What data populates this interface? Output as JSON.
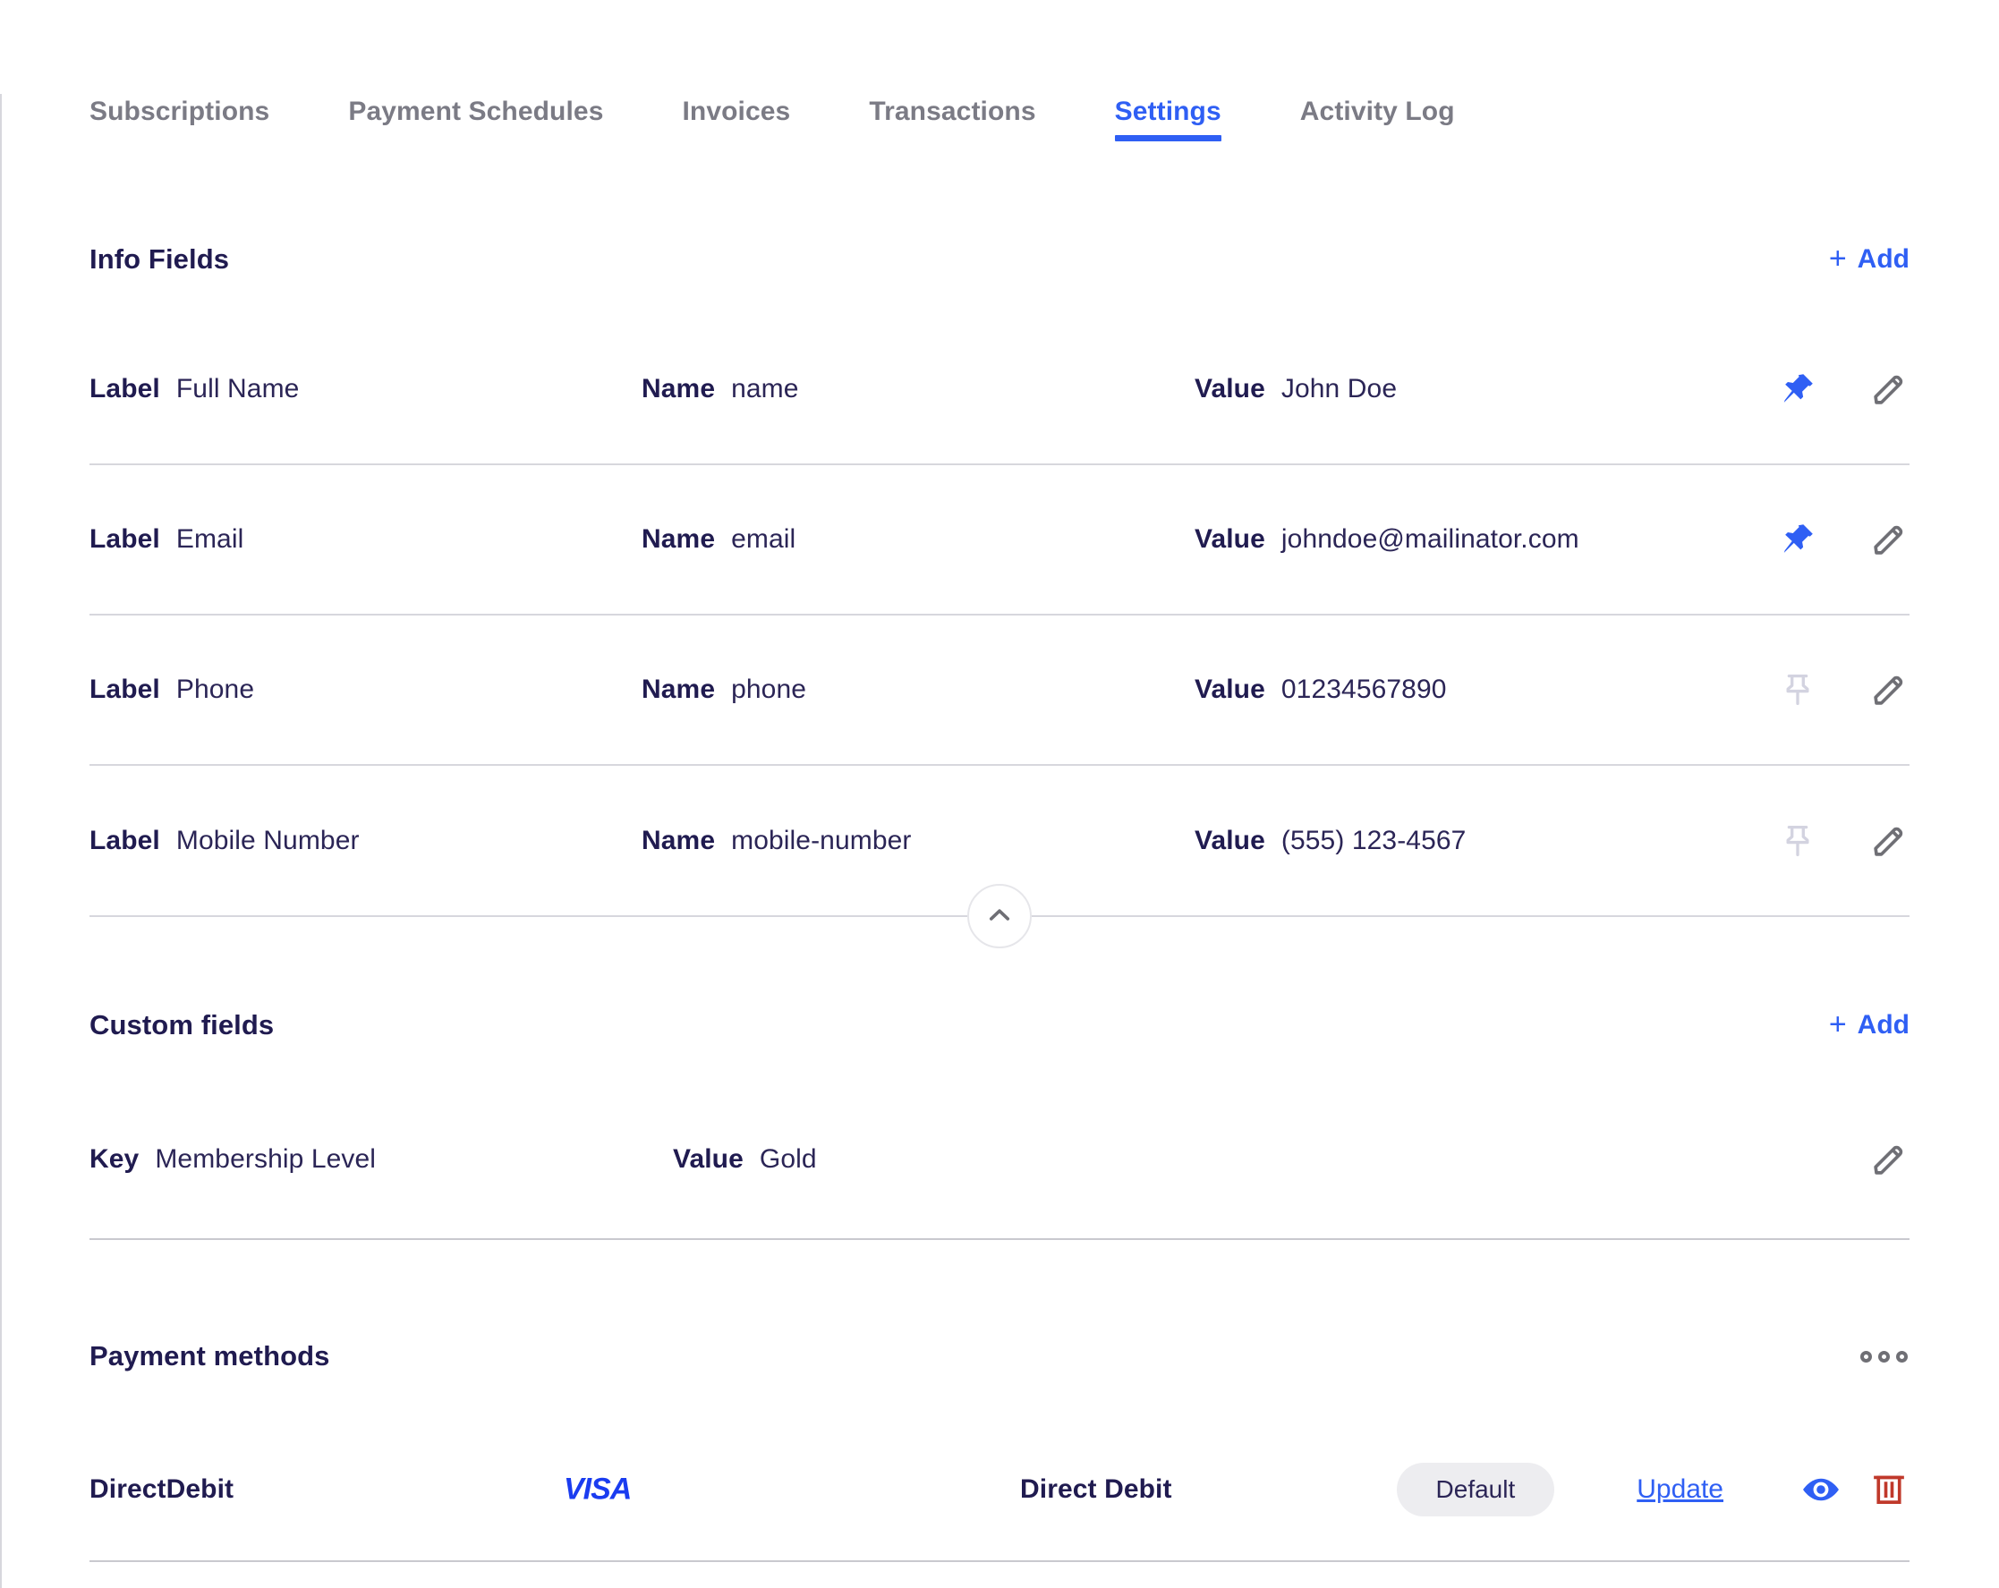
{
  "tabs": [
    {
      "label": "Subscriptions",
      "active": false
    },
    {
      "label": "Payment Schedules",
      "active": false
    },
    {
      "label": "Invoices",
      "active": false
    },
    {
      "label": "Transactions",
      "active": false
    },
    {
      "label": "Settings",
      "active": true
    },
    {
      "label": "Activity Log",
      "active": false
    }
  ],
  "colors": {
    "accent": "#2f5ff4",
    "heading": "#201b50",
    "text": "#2b2556",
    "muted": "#7b7b85",
    "divider": "#d7d7dd",
    "pin_off": "#d3d3e0",
    "pencil": "#6f6f75",
    "danger": "#c0392b",
    "badge_bg": "#ededf0",
    "visa": "#1a3cf0"
  },
  "info_fields": {
    "title": "Info Fields",
    "add_label": "Add",
    "add_icon": "plus-icon",
    "collapse_icon": "chevron-up-icon",
    "columns": {
      "label": "Label",
      "name": "Name",
      "value": "Value"
    },
    "rows": [
      {
        "label_key": "Label",
        "label": "Full Name",
        "name_key": "Name",
        "name": "name",
        "value_key": "Value",
        "value": "John Doe",
        "pinned": true,
        "pin_icon": "pin-filled-icon",
        "edit_icon": "pencil-icon"
      },
      {
        "label_key": "Label",
        "label": "Email",
        "name_key": "Name",
        "name": "email",
        "value_key": "Value",
        "value": "johndoe@mailinator.com",
        "pinned": true,
        "pin_icon": "pin-filled-icon",
        "edit_icon": "pencil-icon"
      },
      {
        "label_key": "Label",
        "label": "Phone",
        "name_key": "Name",
        "name": "phone",
        "value_key": "Value",
        "value": "01234567890",
        "pinned": false,
        "pin_icon": "pin-outline-icon",
        "edit_icon": "pencil-icon"
      },
      {
        "label_key": "Label",
        "label": "Mobile Number",
        "name_key": "Name",
        "name": "mobile-number",
        "value_key": "Value",
        "value": "(555) 123-4567",
        "pinned": false,
        "pin_icon": "pin-outline-icon",
        "edit_icon": "pencil-icon"
      }
    ]
  },
  "custom_fields": {
    "title": "Custom fields",
    "add_label": "Add",
    "add_icon": "plus-icon",
    "rows": [
      {
        "key_key": "Key",
        "key": "Membership Level",
        "value_key": "Value",
        "value": "Gold",
        "edit_icon": "pencil-icon"
      }
    ]
  },
  "payment_methods": {
    "title": "Payment methods",
    "menu_icon": "more-horizontal-icon",
    "rows": [
      {
        "name": "DirectDebit",
        "brand": "VISA",
        "type": "Direct Debit",
        "badge": "Default",
        "update_label": "Update",
        "view_icon": "eye-icon",
        "delete_icon": "trash-icon"
      }
    ]
  }
}
